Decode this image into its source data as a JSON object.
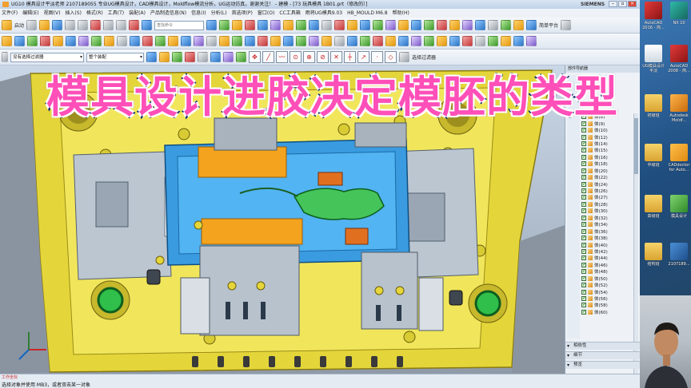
{
  "window": {
    "title": "UG10 模具设计平淡老师 2107189055 专业UG模具设计，CAD模具设计，Moldflow模流分析，UG运动仿真，谢谢关注！ - 建模 - [73 玩具模具 1B01.prt（修改的）]",
    "brand": "SIEMENS",
    "controls": [
      "–",
      "▫",
      "×"
    ]
  },
  "menu": {
    "items": [
      "文件(F)",
      "编辑(E)",
      "视图(V)",
      "插入(S)",
      "格式(R)",
      "工具(T)",
      "装配(A)",
      "产品制造信息(N)",
      "信息(I)",
      "分析(L)",
      "首选项(P)",
      "窗口(O)",
      "CC工具箱",
      "雨将UG模具9.03",
      "HB_MOULD M6.8",
      "帮助(H)"
    ]
  },
  "toolbar": {
    "start_label": "启动",
    "search_placeholder": "查找命令",
    "simple_label": "简单平台",
    "filter_value": "没有选择过滤器",
    "assembly_value": "整个装配",
    "select_label": "选择过滤器",
    "icon_names": [
      "new-icon",
      "open-icon",
      "save-icon",
      "undo-icon",
      "redo-icon",
      "cut-icon",
      "copy-icon",
      "paste-icon",
      "delete-icon",
      "sketch-icon",
      "extrude-icon",
      "revolve-icon",
      "hole-icon",
      "blend-icon",
      "chamfer-icon",
      "shell-icon",
      "pattern-icon",
      "mirror-icon",
      "trim-icon",
      "measure-icon"
    ]
  },
  "overlay": {
    "title": "模具设计进胶决定模胚的类型"
  },
  "part_navigator": {
    "header": "部件导航器",
    "items": [
      "体(8)",
      "体(9)",
      "体(10)",
      "体(12)",
      "体(14)",
      "体(15)",
      "体(16)",
      "体(18)",
      "体(20)",
      "体(22)",
      "体(24)",
      "体(26)",
      "体(27)",
      "体(28)",
      "体(30)",
      "体(32)",
      "体(34)",
      "体(36)",
      "体(38)",
      "体(40)",
      "体(42)",
      "体(44)",
      "体(46)",
      "体(48)",
      "体(50)",
      "体(52)",
      "体(54)",
      "体(56)",
      "体(58)",
      "体(60)"
    ],
    "sections": [
      "相依性",
      "细节",
      "预览"
    ]
  },
  "status": {
    "cue": "选择对象并使用 MB3，或者双击某一对象",
    "ucs": "工作坐标"
  },
  "desktop": {
    "icons": [
      {
        "label": "AutoCAD 2016 - 简...",
        "icon": "autocad-icon"
      },
      {
        "label": "NX 10",
        "icon": "nx-icon"
      },
      {
        "label": "UG模具设计平淡",
        "icon": "folder-icon"
      },
      {
        "label": "AutoCAD 2008 - 简...",
        "icon": "autocad-icon"
      },
      {
        "label": "初级班",
        "icon": "folder-icon"
      },
      {
        "label": "Autodesk Moldf...",
        "icon": "moldflow-icon"
      },
      {
        "label": "中级班",
        "icon": "folder-icon"
      },
      {
        "label": "CADdoctor for Auto...",
        "icon": "caddoctor-icon"
      },
      {
        "label": "高级班",
        "icon": "folder-icon"
      },
      {
        "label": "模具设计",
        "icon": "folder-icon"
      },
      {
        "label": "结构班",
        "icon": "folder-icon"
      },
      {
        "label": "2107189...",
        "icon": "video-icon"
      }
    ]
  }
}
